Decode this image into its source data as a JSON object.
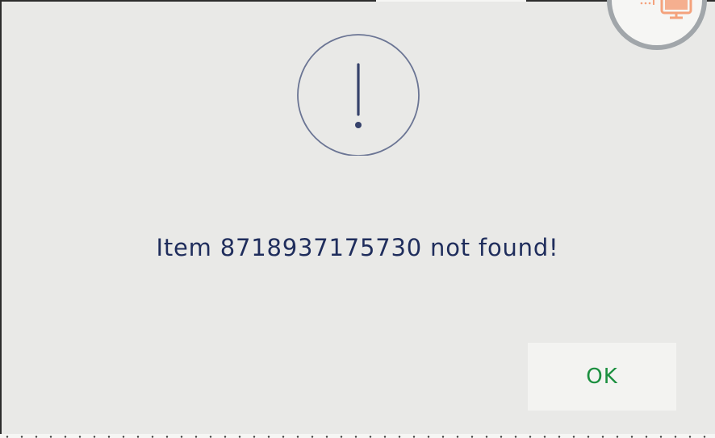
{
  "dialog": {
    "message": "Item 8718937175730 not found!",
    "ok_label": "OK",
    "icon": "exclamation-icon"
  },
  "background": {
    "corner_icon": "monitor-icon"
  },
  "colors": {
    "dialog_background": "#e9e9e7",
    "message_text": "#1f2d5c",
    "icon_stroke": "#6b7594",
    "icon_glyph": "#36426b",
    "ok_text": "#1b8f3f",
    "ok_background": "#f3f3f1",
    "corner_ring": "#a1a6aa",
    "corner_icon": "#f4a27c"
  }
}
